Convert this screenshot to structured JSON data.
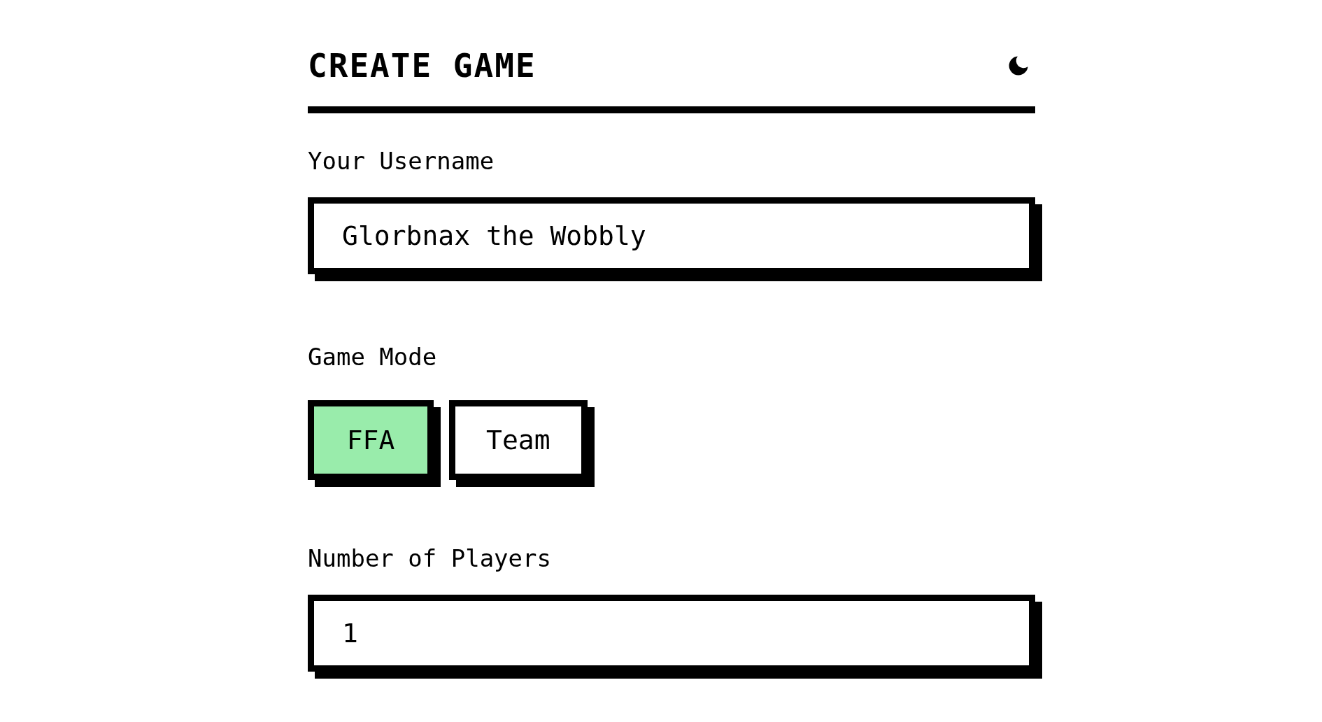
{
  "title": "CREATE GAME",
  "username": {
    "label": "Your Username",
    "value": "Glorbnax the Wobbly"
  },
  "game_mode": {
    "label": "Game Mode",
    "options": [
      {
        "label": "FFA",
        "selected": true
      },
      {
        "label": "Team",
        "selected": false
      }
    ]
  },
  "players": {
    "label": "Number of Players",
    "value": "1"
  }
}
